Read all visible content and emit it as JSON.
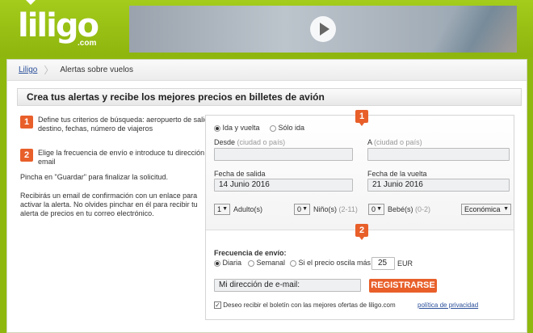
{
  "header": {
    "logo_main": "liligo",
    "logo_com": ".com",
    "video_play_icon": "play-icon"
  },
  "breadcrumb": {
    "home": "Liligo",
    "current": "Alertas sobre vuelos"
  },
  "page_title": "Crea tus alertas y recibe los mejores precios en billetes de avión",
  "steps": [
    {
      "number": "1",
      "text": "Define tus criterios de búsqueda: aeropuerto de salida, destino, fechas, número de viajeros"
    },
    {
      "number": "2",
      "text": "Elige la frecuencia de envío e introduce tu dirección de email"
    }
  ],
  "instructions": {
    "save_hint": "Pincha en \"Guardar\" para finalizar la solicitud.",
    "confirm_hint": "Recibirás un email de confirmación con un enlace para activar la alerta. No olvides pinchar en él para recibir tu alerta de precios en tu correo electrónico."
  },
  "form": {
    "section1_badge": "1",
    "section2_badge": "2",
    "trip_type": {
      "round_trip": "Ida y vuelta",
      "one_way": "Sólo ida",
      "selected": "round_trip"
    },
    "from_label": "Desde",
    "from_hint": "(ciudad o país)",
    "from_value": "",
    "to_label": "A",
    "to_hint": "(ciudad o país)",
    "to_value": "",
    "depart_label": "Fecha de salida",
    "depart_value": "14 Junio 2016",
    "return_label": "Fecha de la vuelta",
    "return_value": "21 Junio 2016",
    "adults_value": "1",
    "adults_label": "Adulto(s)",
    "children_value": "0",
    "children_label": "Niño(s)",
    "children_hint": "(2-11)",
    "babies_value": "0",
    "babies_label": "Bebé(s)",
    "babies_hint": "(0-2)",
    "cabin_value": "Económica",
    "frequency_label": "Frecuencia de envío:",
    "freq_daily": "Diaria",
    "freq_weekly": "Semanal",
    "freq_price": "Si el precio oscila más de",
    "freq_selected": "daily",
    "price_threshold": "25",
    "currency": "EUR",
    "email_placeholder": "Mi dirección de e-mail:",
    "register_button": "REGISTRARSE",
    "newsletter_label": "Deseo recibir el boletín con las mejores ofertas de liligo.com",
    "newsletter_checked": true,
    "privacy_link": "política de privacidad"
  },
  "colors": {
    "brand_green": "#8fb80e",
    "accent_orange": "#e85f2a",
    "link_blue": "#2a4f9a"
  }
}
